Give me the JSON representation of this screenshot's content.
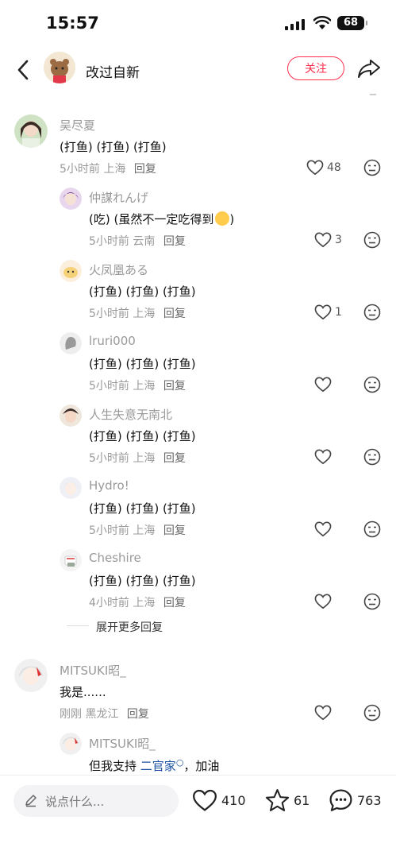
{
  "status_bar": {
    "time": "15:57",
    "battery": "68"
  },
  "header": {
    "title": "改过自新",
    "follow_label": "关注"
  },
  "comments": [
    {
      "name": "吴尽夏",
      "text": "(打鱼) (打鱼) (打鱼)",
      "time": "5小时前",
      "location": "上海",
      "reply": "回复",
      "likes": "48"
    },
    {
      "name": "仲謀れんげ",
      "text": "(吃) (虽然不一定吃得到",
      "time": "5小时前",
      "location": "云南",
      "reply": "回复",
      "likes": "3"
    },
    {
      "name": "火凤凰ある",
      "text": "(打鱼) (打鱼) (打鱼)",
      "time": "5小时前",
      "location": "上海",
      "reply": "回复",
      "likes": "1"
    },
    {
      "name": "lruri000",
      "text": "(打鱼) (打鱼) (打鱼)",
      "time": "5小时前",
      "location": "上海",
      "reply": "回复",
      "likes": ""
    },
    {
      "name": "人生失意无南北",
      "text": "(打鱼) (打鱼) (打鱼)",
      "time": "5小时前",
      "location": "上海",
      "reply": "回复",
      "likes": ""
    },
    {
      "name": "Hydro!",
      "text": "(打鱼) (打鱼) (打鱼)",
      "time": "5小时前",
      "location": "上海",
      "reply": "回复",
      "likes": ""
    },
    {
      "name": "Cheshire",
      "text": "(打鱼) (打鱼) (打鱼)",
      "time": "4小时前",
      "location": "上海",
      "reply": "回复",
      "likes": ""
    },
    {
      "name": "MITSUKI昭_",
      "text": "我是......",
      "time": "刚刚",
      "location": "黑龙江",
      "reply": "回复",
      "likes": ""
    },
    {
      "name": "MITSUKI昭_",
      "text_prefix": "但我支持",
      "text_link": "二官家",
      "text_suffix": "，加油"
    }
  ],
  "expand_label": "展开更多回复",
  "bottom_bar": {
    "placeholder": "说点什么...",
    "likes": "410",
    "favorites": "61",
    "comments": "763"
  },
  "colors": {
    "accent": "#ff2e4d",
    "link": "#1a4fa3"
  }
}
